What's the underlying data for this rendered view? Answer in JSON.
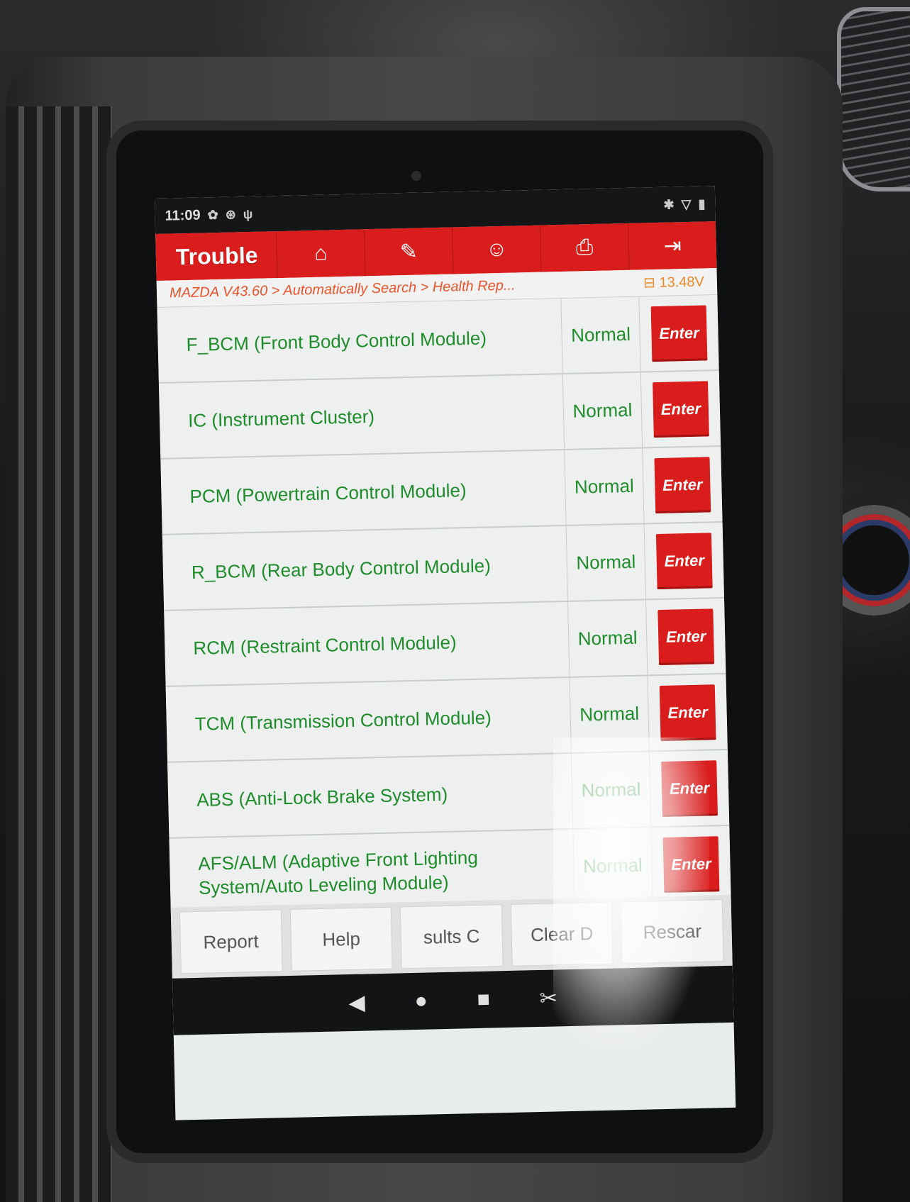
{
  "status_bar": {
    "time": "11:09",
    "icons": [
      "gear-icon",
      "settings-badge-icon",
      "stethoscope-icon"
    ],
    "right_icons": [
      "bluetooth-icon",
      "wifi-icon",
      "battery-icon"
    ]
  },
  "toolbar": {
    "title": "Trouble",
    "buttons": [
      {
        "name": "home",
        "icon": "home-icon",
        "glyph": "⌂"
      },
      {
        "name": "edit",
        "icon": "edit-icon",
        "glyph": "✎"
      },
      {
        "name": "support",
        "icon": "person-headset-icon",
        "glyph": "☺"
      },
      {
        "name": "print",
        "icon": "printer-icon",
        "glyph": "⎙"
      },
      {
        "name": "exit",
        "icon": "exit-icon",
        "glyph": "⇥"
      }
    ]
  },
  "breadcrumb": {
    "path": "MAZDA V43.60 > Automatically Search > Health Rep...",
    "voltage": "13.48V"
  },
  "modules": [
    {
      "name": "F_BCM (Front Body Control Module)",
      "status": "Normal",
      "action": "Enter"
    },
    {
      "name": "IC (Instrument Cluster)",
      "status": "Normal",
      "action": "Enter"
    },
    {
      "name": "PCM (Powertrain Control Module)",
      "status": "Normal",
      "action": "Enter"
    },
    {
      "name": "R_BCM (Rear Body Control Module)",
      "status": "Normal",
      "action": "Enter"
    },
    {
      "name": "RCM (Restraint Control Module)",
      "status": "Normal",
      "action": "Enter"
    },
    {
      "name": "TCM (Transmission Control Module)",
      "status": "Normal",
      "action": "Enter"
    },
    {
      "name": "ABS (Anti-Lock Brake System)",
      "status": "Normal",
      "action": "Enter"
    },
    {
      "name": "AFS/ALM (Adaptive Front Lighting System/Auto Leveling Module)",
      "status": "Normal",
      "action": "Enter"
    }
  ],
  "bottom_buttons": [
    "Report",
    "Help",
    "sults C",
    "Clear D",
    "Rescar"
  ],
  "nav_bar": {
    "back": "◀",
    "home": "●",
    "recents": "■",
    "screenshot": "✂"
  },
  "colors": {
    "accent_red": "#d91c1c",
    "module_green": "#1f8c2b",
    "breadcrumb_orange": "#e8542c"
  }
}
